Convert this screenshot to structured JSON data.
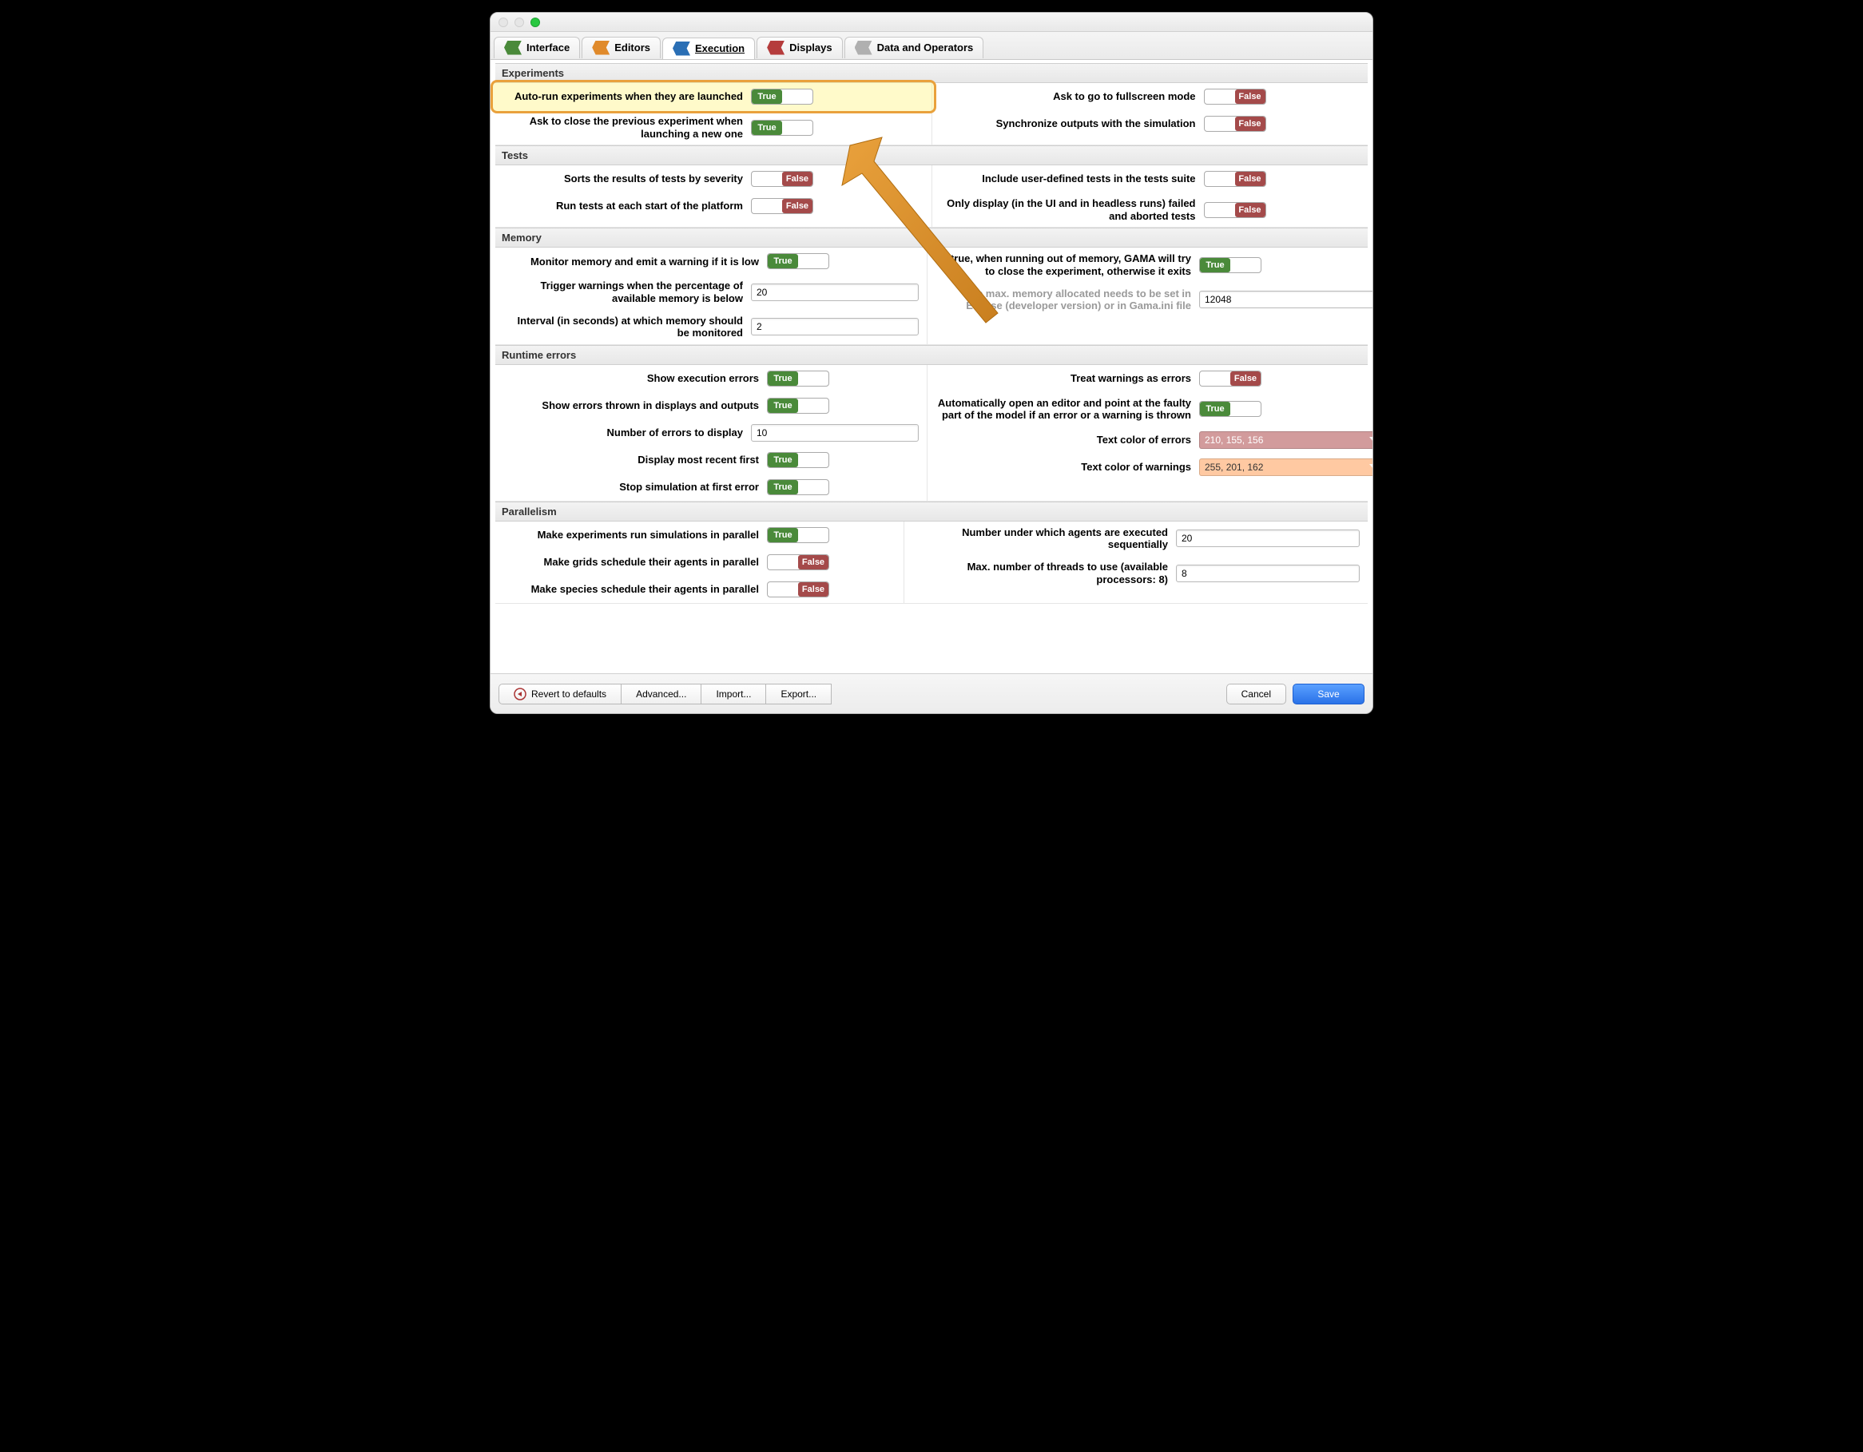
{
  "tabs": {
    "interface": "Interface",
    "editors": "Editors",
    "execution": "Execution",
    "displays": "Displays",
    "data": "Data and Operators"
  },
  "sections": {
    "experiments": "Experiments",
    "tests": "Tests",
    "memory": "Memory",
    "runtime": "Runtime errors",
    "parallel": "Parallelism"
  },
  "exp": {
    "autorun": "Auto-run experiments when they are launched",
    "autorun_val": "True",
    "close_prev": "Ask to close the previous experiment when launching a new one",
    "close_prev_val": "True",
    "fullscreen": "Ask to go to fullscreen mode",
    "fullscreen_val": "False",
    "sync": "Synchronize outputs with the simulation",
    "sync_val": "False"
  },
  "tests": {
    "sort": "Sorts the results of tests by severity",
    "sort_val": "False",
    "startup": "Run tests at each start of the platform",
    "startup_val": "False",
    "include": "Include user-defined tests in the tests suite",
    "include_val": "False",
    "failed": "Only display (in the UI and in headless runs) failed and aborted tests",
    "failed_val": "False"
  },
  "mem": {
    "monitor": "Monitor memory and emit a warning if it is low",
    "monitor_val": "True",
    "trigger": "Trigger warnings when the percentage of available memory is below",
    "trigger_val": "20",
    "interval": "Interval (in seconds) at which memory should be monitored",
    "interval_val": "2",
    "oom": "If true, when running out of memory, GAMA will try to close the experiment, otherwise it exits",
    "oom_val": "True",
    "max": "The max. memory allocated needs to be set in Eclipse (developer version) or in Gama.ini file",
    "max_val": "12048"
  },
  "rt": {
    "show": "Show execution errors",
    "show_val": "True",
    "disp": "Show errors thrown in displays and outputs",
    "disp_val": "True",
    "num": "Number of errors to display",
    "num_val": "10",
    "recent": "Display most recent first",
    "recent_val": "True",
    "stop": "Stop simulation at first error",
    "stop_val": "True",
    "warn": "Treat warnings as errors",
    "warn_val": "False",
    "open": "Automatically open an editor and point at the faulty part of the model if an error or a warning is thrown",
    "open_val": "True",
    "cerr": "Text color of errors",
    "cerr_val": "210, 155, 156",
    "cwarn": "Text color of warnings",
    "cwarn_val": "255, 201, 162"
  },
  "par": {
    "exp": "Make experiments run simulations in parallel",
    "exp_val": "True",
    "grids": "Make grids schedule their agents in parallel",
    "grids_val": "False",
    "species": "Make species schedule their agents in parallel",
    "species_val": "False",
    "seq": "Number under which agents are executed sequentially",
    "seq_val": "20",
    "threads": "Max. number of threads to use (available processors: 8)",
    "threads_val": "8"
  },
  "bottom": {
    "revert": "Revert to defaults",
    "advanced": "Advanced...",
    "import": "Import...",
    "export": "Export...",
    "cancel": "Cancel",
    "save": "Save"
  },
  "colors": {
    "err_bg": "#d29b9c",
    "warn_bg": "#ffc9a2"
  }
}
